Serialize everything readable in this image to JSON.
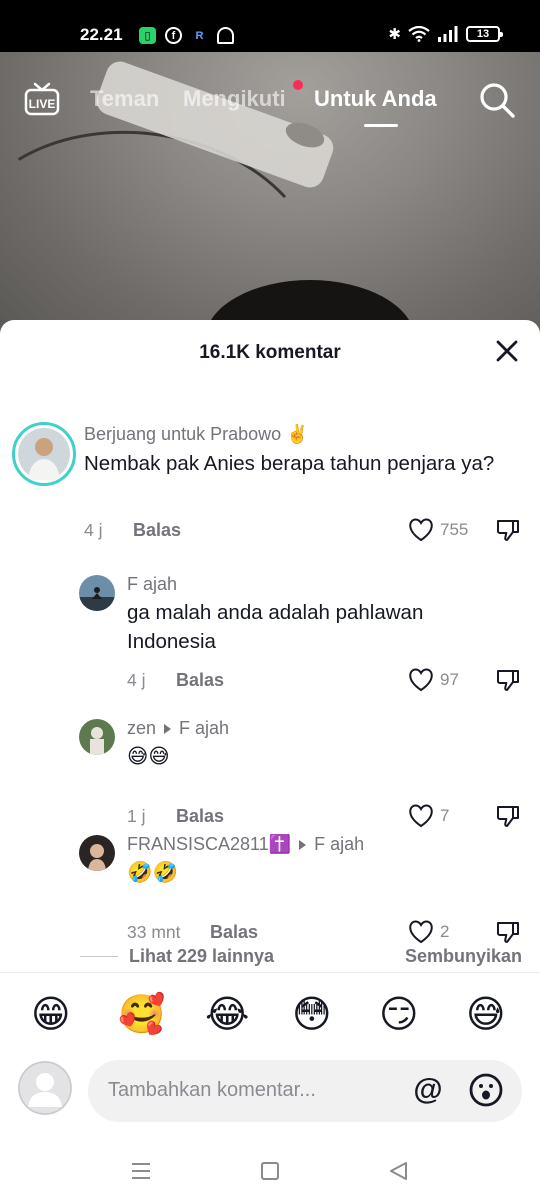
{
  "status_bar": {
    "time": "22.21",
    "battery": "13",
    "icons": [
      "wechat-like-app-icon",
      "facebook-icon",
      "r-app-icon",
      "q-app-icon",
      "bluetooth-icon",
      "vibrate-icon",
      "wifi-icon",
      "signal-icon"
    ]
  },
  "top_nav": {
    "live_label": "LIVE",
    "tabs": [
      "Teman",
      "Mengikuti",
      "Untuk Anda"
    ],
    "active_tab": "Untuk Anda"
  },
  "comments_sheet": {
    "title": "16.1K komentar",
    "comments": [
      {
        "username": "Berjuang untuk Prabowo ✌️",
        "text": "Nembak pak Anies berapa tahun penjara ya?",
        "time": "4 j",
        "reply_label": "Balas",
        "likes": "755"
      },
      {
        "username": "F ajah",
        "text": "ga malah anda adalah pahlawan Indonesia",
        "time": "4 j",
        "reply_label": "Balas",
        "likes": "97"
      },
      {
        "username": "zen",
        "reply_to": "F ajah",
        "text": "😅😅",
        "time": "1 j",
        "reply_label": "Balas",
        "likes": "7"
      },
      {
        "username": "FRANSISCA2811✝️",
        "reply_to": "F ajah",
        "text": "🤣🤣",
        "time": "33 mnt",
        "reply_label": "Balas",
        "likes": "2"
      }
    ],
    "view_more": "Lihat 229 lainnya",
    "hide": "Sembunyikan"
  },
  "quick_emojis": [
    "😁",
    "🥰",
    "😂",
    "😳",
    "😏",
    "😅"
  ],
  "input": {
    "placeholder": "Tambahkan komentar..."
  },
  "colors": {
    "accent_red": "#fe2c55",
    "text_primary": "#161823",
    "text_secondary": "#73747b"
  }
}
